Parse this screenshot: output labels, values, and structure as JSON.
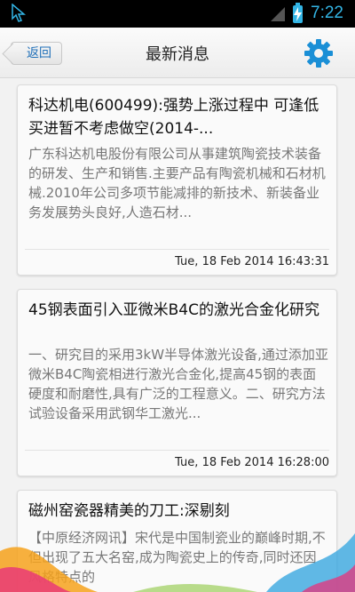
{
  "status_bar": {
    "time": "7:22",
    "icons": [
      "cursor-icon",
      "signal-icon",
      "battery-charging-icon"
    ]
  },
  "header": {
    "back_label": "返回",
    "title": "最新消息",
    "settings_icon": "gear-icon"
  },
  "colors": {
    "accent": "#33b5e5",
    "link": "#1f6fb8",
    "gear": "#1a8fd6"
  },
  "news": [
    {
      "title": "科达机电(600499):强势上涨过程中 可逢低买进暂不考虑做空(2014-...",
      "summary": "  广东科达机电股份有限公司从事建筑陶瓷技术装备的研发、生产和销售.主要产品有陶瓷机械和石材机械.2010年公司多项节能减排的新技术、新装备业务发展势头良好,人造石材...",
      "time": "Tue, 18 Feb 2014 16:43:31"
    },
    {
      "title": "45钢表面引入亚微米B4C的激光合金化研究",
      "summary": "一、研究目的采用3kW半导体激光设备,通过添加亚微米B4C陶瓷相进行激光合金化,提高45钢的表面硬度和耐磨性,具有广泛的工程意义。二、研究方法试验设备采用武钢华工激光...",
      "time": "Tue, 18 Feb 2014 16:28:00"
    },
    {
      "title": "磁州窑瓷器精美的刀工:深剔刻",
      "summary": "【中原经济网讯】宋代是中国制瓷业的巅峰时期,不但出现了五大名窑,成为陶瓷史上的传奇,同时还因风格特点的"
    }
  ]
}
